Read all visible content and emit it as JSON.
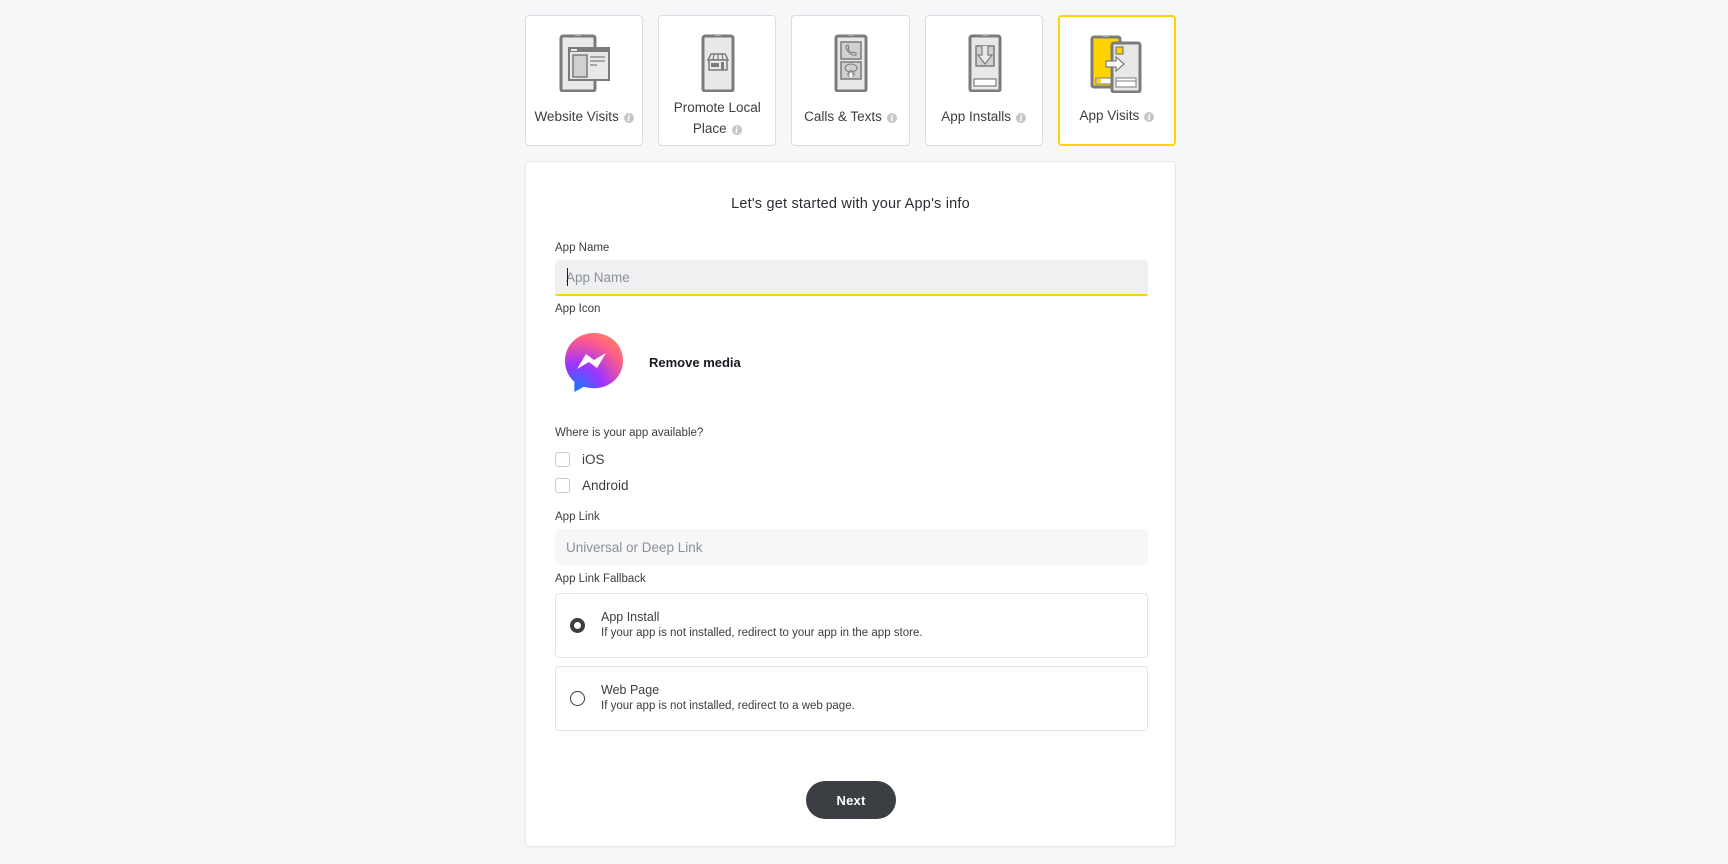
{
  "objectives": {
    "tiles": [
      {
        "id": "website-visits",
        "label": "Website Visits",
        "icon": "website-visits-icon",
        "selected": false
      },
      {
        "id": "promote-local-place",
        "label": "Promote Local Place",
        "icon": "storefront-icon",
        "selected": false
      },
      {
        "id": "calls-texts",
        "label": "Calls & Texts",
        "icon": "phone-chat-icon",
        "selected": false
      },
      {
        "id": "app-installs",
        "label": "App Installs",
        "icon": "download-icon",
        "selected": false
      },
      {
        "id": "app-visits",
        "label": "App Visits",
        "icon": "app-visits-icon",
        "selected": true
      }
    ],
    "info_glyph": "i",
    "accent_color": "#ffd400"
  },
  "form": {
    "heading": "Let's get started with your App's info",
    "app_name": {
      "label": "App Name",
      "placeholder": "App Name",
      "value": ""
    },
    "app_icon": {
      "label": "App Icon",
      "icon": "messenger-app-icon",
      "remove_label": "Remove media"
    },
    "availability": {
      "label": "Where is your app available?",
      "options": [
        {
          "label": "iOS",
          "checked": false
        },
        {
          "label": "Android",
          "checked": false
        }
      ]
    },
    "app_link": {
      "label": "App Link",
      "placeholder": "Universal or Deep Link",
      "value": ""
    },
    "fallback": {
      "label": "App Link Fallback",
      "options": [
        {
          "title": "App Install",
          "description": "If your app is not installed, redirect to your app in the app store.",
          "selected": true
        },
        {
          "title": "Web Page",
          "description": "If your app is not installed, redirect to a web page.",
          "selected": false
        }
      ]
    },
    "next_label": "Next"
  }
}
